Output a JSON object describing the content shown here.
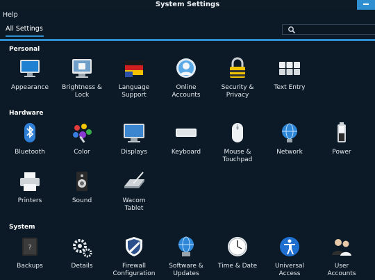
{
  "window": {
    "title": "System Settings"
  },
  "menu": {
    "help": "Help"
  },
  "toolbar": {
    "all_settings": "All Settings"
  },
  "sections": {
    "personal": "Personal",
    "hardware": "Hardware",
    "system": "System"
  },
  "items": {
    "appearance": "Appearance",
    "brightness": "Brightness &\nLock",
    "language": "Language\nSupport",
    "online": "Online\nAccounts",
    "security": "Security &\nPrivacy",
    "text_entry": "Text Entry",
    "bluetooth": "Bluetooth",
    "color": "Color",
    "displays": "Displays",
    "keyboard": "Keyboard",
    "mouse": "Mouse &\nTouchpad",
    "network": "Network",
    "power": "Power",
    "printers": "Printers",
    "sound": "Sound",
    "wacom": "Wacom\nTablet",
    "backups": "Backups",
    "details": "Details",
    "firewall": "Firewall\nConfiguration",
    "software": "Software &\nUpdates",
    "time": "Time & Date",
    "universal": "Universal\nAccess",
    "users": "User\nAccounts"
  },
  "colors": {
    "accent": "#2f8fd0",
    "background": "#0b1a26"
  }
}
